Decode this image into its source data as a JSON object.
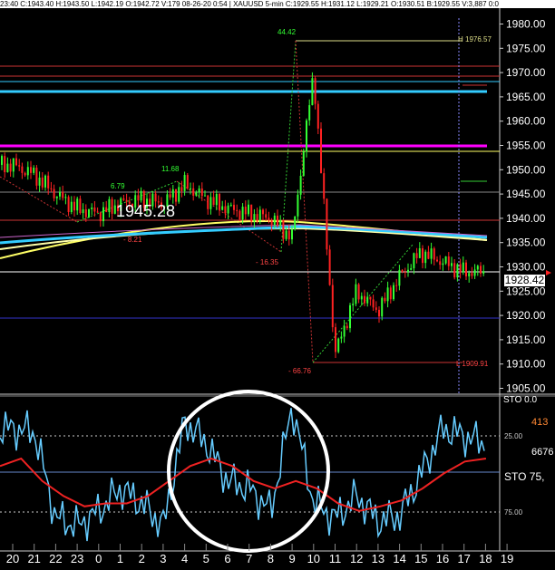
{
  "header": {
    "info": "23:40  C:1943.40  H:1943.50  L:1942.19  O:1942.72  V:179  08-26-20  0:54   |  XAUUSD  5-min  C:1929.55  H:1931.12  L:1929.21  O:1930.51  B:1929.55  V:3,887  0:0"
  },
  "price_axis": {
    "ticks": [
      "1980.00",
      "1975.00",
      "1970.00",
      "1965.00",
      "1960.00",
      "1955.00",
      "1950.00",
      "1945.00",
      "1940.00",
      "1935.00",
      "1930.00",
      "1925.00",
      "1920.00",
      "1915.00",
      "1910.00",
      "1905.00"
    ]
  },
  "current_price": "1928.42",
  "big_price_label": "1945.28",
  "annotations": {
    "peak": "44.42",
    "high_label": "H 1976.57",
    "low_label": "L 1909.91",
    "a1": "11.68",
    "a2": "6.79",
    "a3": "- 8.21",
    "a4": "- 16.35",
    "a5": "- 66.76"
  },
  "osc_axis": {
    "top_label": "STO  0.0",
    "v413": "413",
    "v25": "25.00",
    "v6676": "6676",
    "sto": "STO  75,",
    "v75": "75.00"
  },
  "time_axis": {
    "labels": [
      "20",
      "21",
      "22",
      "23",
      "0",
      "1",
      "2",
      "3",
      "4",
      "5",
      "6",
      "7",
      "8",
      "9",
      "10",
      "11",
      "12",
      "13",
      "14",
      "15",
      "16",
      "17",
      "18",
      "19"
    ]
  },
  "colors": {
    "cyan": "#33ccff",
    "magenta": "#ff00ff",
    "yellow": "#ffff66",
    "red": "#ff2222",
    "green": "#33ff33",
    "osc_line": "#66ccff",
    "white": "#ffffff"
  },
  "chart_data": [
    {
      "type": "line",
      "title": "XAUUSD 5-min",
      "xlabel": "",
      "ylabel": "",
      "ylim": [
        1905,
        1982
      ],
      "x": [
        "20",
        "21",
        "22",
        "23",
        "0",
        "1",
        "2",
        "3",
        "4",
        "5",
        "6",
        "7",
        "8",
        "9",
        "10",
        "11",
        "12",
        "13",
        "14",
        "15",
        "16",
        "17",
        "18",
        "19"
      ],
      "series": [
        {
          "values": [
            1951,
            1949,
            1945,
            1942,
            1941,
            1943,
            1944,
            1943,
            1947,
            1944,
            1942,
            1941,
            1940,
            1936,
            1970,
            1912,
            1925,
            1921,
            1928,
            1933,
            1931,
            1929,
            1929,
            1928
          ]
        }
      ],
      "horizontal_levels": [
        1976.57,
        1971.5,
        1968.5,
        1966,
        1955.2,
        1954,
        1945,
        1939.8,
        1929.5,
        1919.5,
        1909.91
      ]
    },
    {
      "type": "line",
      "title": "STO",
      "xlabel": "",
      "ylabel": "",
      "ylim": [
        0,
        100
      ],
      "x": [
        "20",
        "21",
        "22",
        "23",
        "0",
        "1",
        "2",
        "3",
        "4",
        "5",
        "6",
        "7",
        "8",
        "9",
        "10",
        "11",
        "12",
        "13",
        "14",
        "15",
        "16",
        "17",
        "18",
        "19"
      ],
      "series": [
        {
          "values": [
            20,
            22,
            80,
            85,
            75,
            60,
            70,
            85,
            15,
            30,
            55,
            60,
            75,
            5,
            70,
            80,
            65,
            82,
            78,
            50,
            20,
            25,
            30,
            35
          ]
        },
        {
          "values": [
            45,
            40,
            55,
            65,
            72,
            70,
            70,
            65,
            55,
            45,
            40,
            45,
            55,
            60,
            55,
            60,
            70,
            75,
            72,
            68,
            60,
            50,
            42,
            40
          ]
        }
      ],
      "levels": [
        25,
        75
      ]
    }
  ]
}
